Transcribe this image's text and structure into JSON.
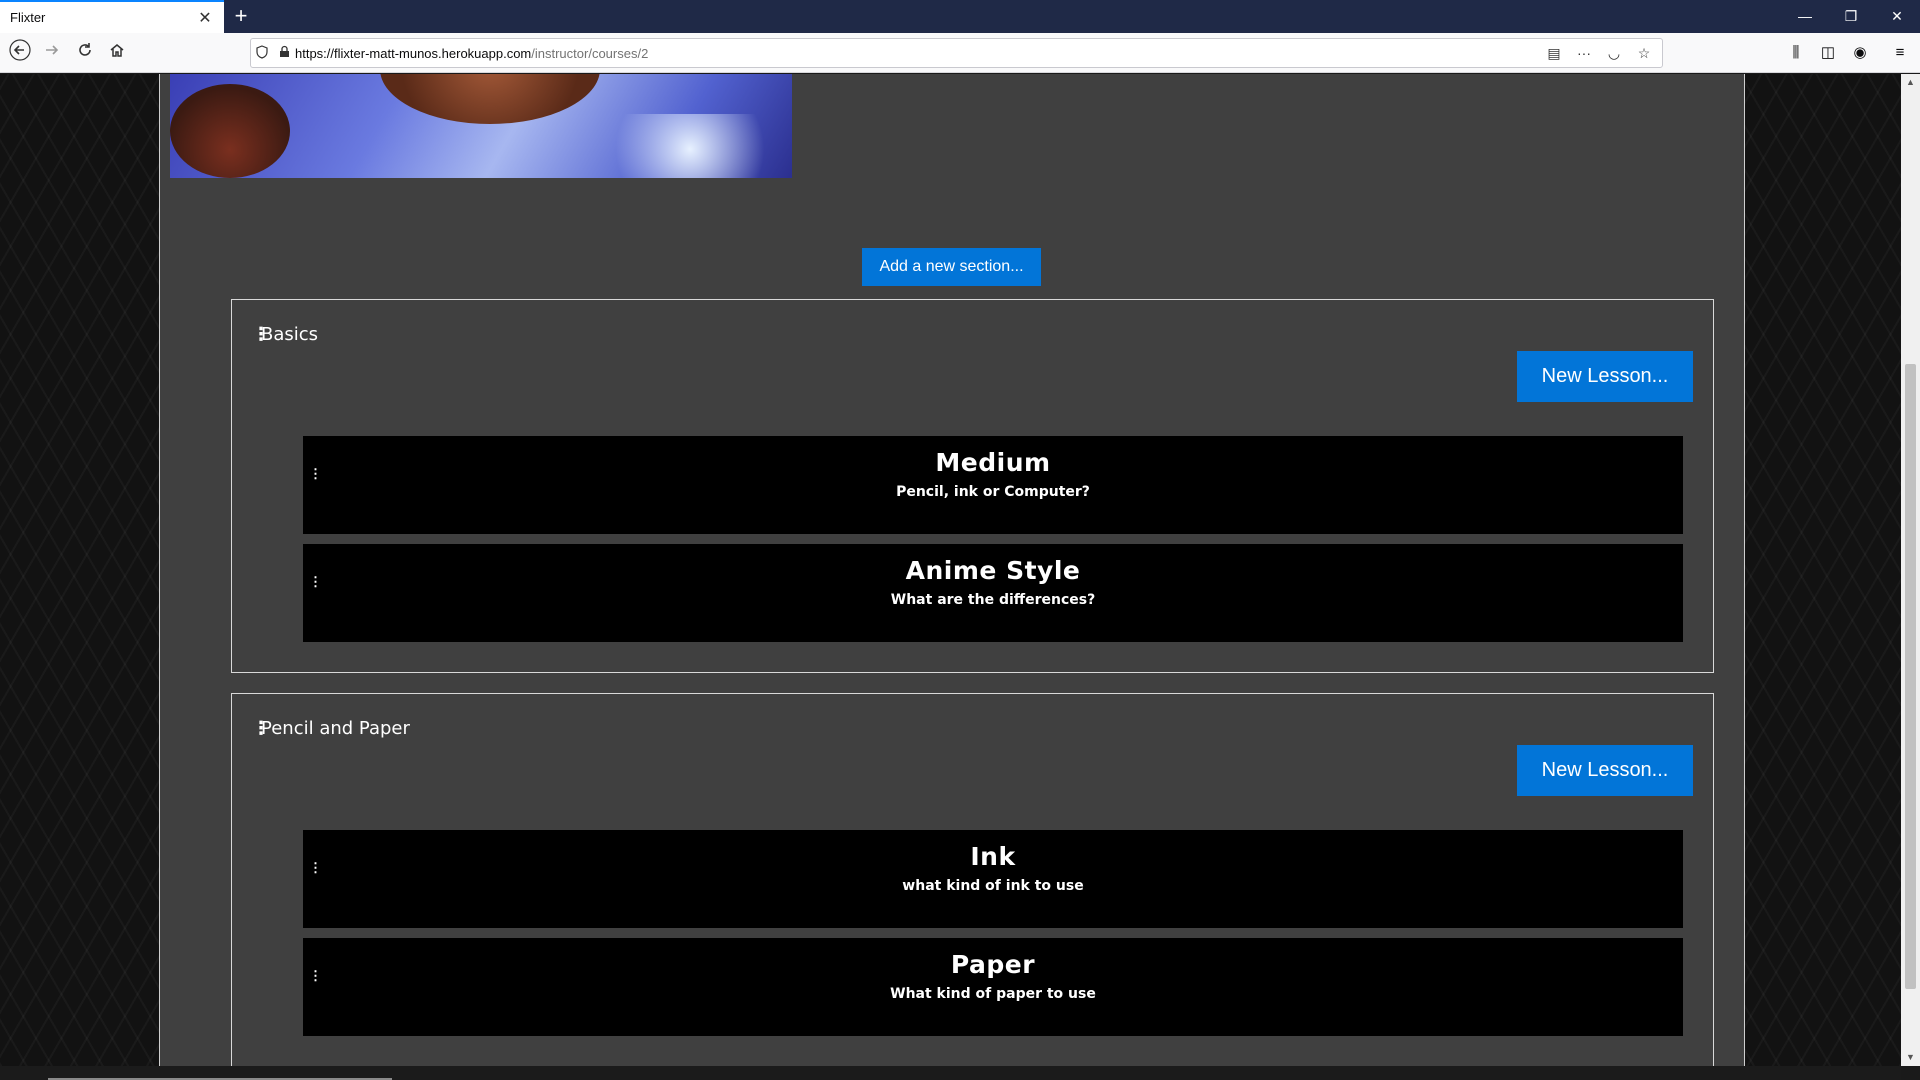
{
  "browser": {
    "tab_title": "Flixter",
    "tab_close": "✕",
    "new_tab": "+",
    "url_host": "https://flixter-matt-munos.herokuapp.com",
    "url_path": "/instructor/courses/2",
    "window_controls": {
      "minimize": "—",
      "restore": "❐",
      "close": "✕"
    }
  },
  "course": {
    "add_section_label": "Add a new section...",
    "sections": [
      {
        "title": "Basics",
        "new_lesson_label": "New Lesson...",
        "lessons": [
          {
            "title": "Medium",
            "subtitle": "Pencil, ink or Computer?"
          },
          {
            "title": "Anime Style",
            "subtitle": "What are the differences?"
          }
        ]
      },
      {
        "title": "Pencil and Paper",
        "new_lesson_label": "New Lesson...",
        "lessons": [
          {
            "title": "Ink",
            "subtitle": "what kind of ink to use"
          },
          {
            "title": "Paper",
            "subtitle": "What kind of paper to use"
          }
        ]
      }
    ]
  },
  "colors": {
    "primary_button": "#0275d8",
    "panel_bg": "#404040",
    "lesson_bg": "#000000",
    "tabbar_bg": "#1f2947"
  }
}
